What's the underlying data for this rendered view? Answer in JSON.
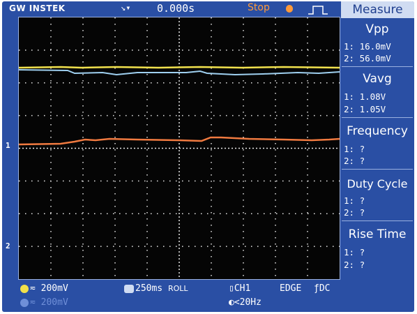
{
  "header": {
    "brand": "GW INSTEK",
    "trigger_icon": "trigger-position-icon",
    "trigger_time": "0.000s",
    "run_status": "Stop",
    "trigger_type_icon": "pulse-icon"
  },
  "waveforms": {
    "ch1_color": "#f2e24e",
    "ch2_color": "#9fd0f0",
    "math_color": "#f07a40",
    "ch1_marker": "1",
    "ch2_marker": "2"
  },
  "measure": {
    "title": "Measure",
    "panels": [
      {
        "label": "Vpp",
        "ch1": "1: 16.0mV",
        "ch2": "2: 56.0mV"
      },
      {
        "label": "Vavg",
        "ch1": "1: 1.08V",
        "ch2": "2: 1.05V"
      },
      {
        "label": "Frequency",
        "ch1": "1:  ?",
        "ch2": "2:  ?"
      },
      {
        "label": "Duty Cycle",
        "ch1": "1:  ?",
        "ch2": "2:  ?"
      },
      {
        "label": "Rise Time",
        "ch1": "1:  ?",
        "ch2": "2:  ?"
      }
    ]
  },
  "footer": {
    "ch1_scale": "200mV",
    "ch2_scale": "200mV",
    "timebase": "250ms",
    "timebase_mode": "ROLL",
    "trigger_source": "CH1",
    "trigger_mode": "EDGE",
    "coupling": "DC",
    "trigger_freq": "<20Hz"
  }
}
